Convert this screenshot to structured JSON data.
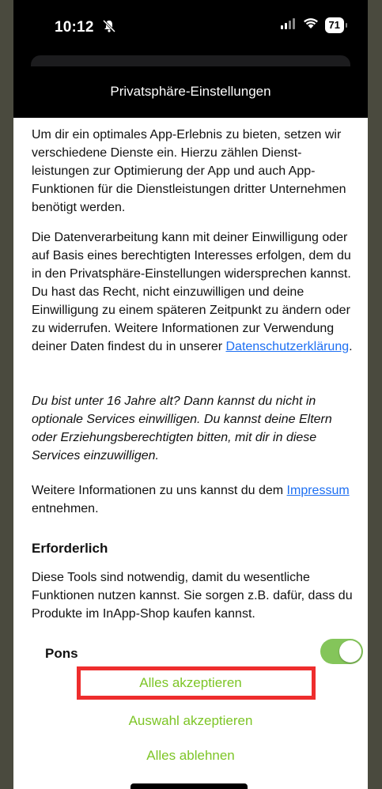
{
  "status_bar": {
    "time": "10:12",
    "battery": "71"
  },
  "header": {
    "title": "Privatsphäre-Einstellungen"
  },
  "intro": {
    "p1": "Um dir ein optimales App-Erlebnis zu bieten, setzen wir verschiedene Dienste ein. Hierzu zählen Dienst-leistungen zur Optimierung der App und auch App-Funktionen für die Dienstleistungen dritter Unternehmen benötigt werden.",
    "p2_text": "Die Datenverarbeitung kann mit deiner Einwilligung oder auf Basis eines berechtigten Interesses erfolgen, dem du in den Privatsphäre-Einstellungen widersprechen kannst. Du hast das Recht, nicht einzuwilligen und deine Einwilligung zu einem späteren Zeitpunkt zu ändern oder zu widerrufen. Weitere Informationen zur Verwendung deiner Daten findest du in unserer ",
    "p2_link": "Datenschutzerklärung",
    "p2_end": ".",
    "p3": "Du bist unter 16 Jahre alt? Dann kannst du nicht in optionale Services einwilligen. Du kannst deine Eltern oder Erziehungsberechtigten bitten, mit dir in diese Services einzuwilligen.",
    "p4_text": "Weitere Informationen zu uns kannst du dem ",
    "p4_link": "Impressum",
    "p4_end": " entnehmen."
  },
  "required": {
    "title": "Erforderlich",
    "description": "Diese Tools sind notwendig, damit du wesentliche Funktionen nutzen kannst. Sie sorgen z.B. dafür, dass du Produkte im InApp-Shop kaufen kannst.",
    "item_label": "Pons",
    "item_enabled": true
  },
  "actions": {
    "accept_all": "Alles akzeptieren",
    "accept_selection": "Auswahl akzeptieren",
    "reject_all": "Alles ablehnen"
  },
  "colors": {
    "accent": "#7dc526",
    "toggle_on": "#84c55a",
    "link": "#1d6ff2",
    "highlight_box": "#ee2d2d"
  }
}
